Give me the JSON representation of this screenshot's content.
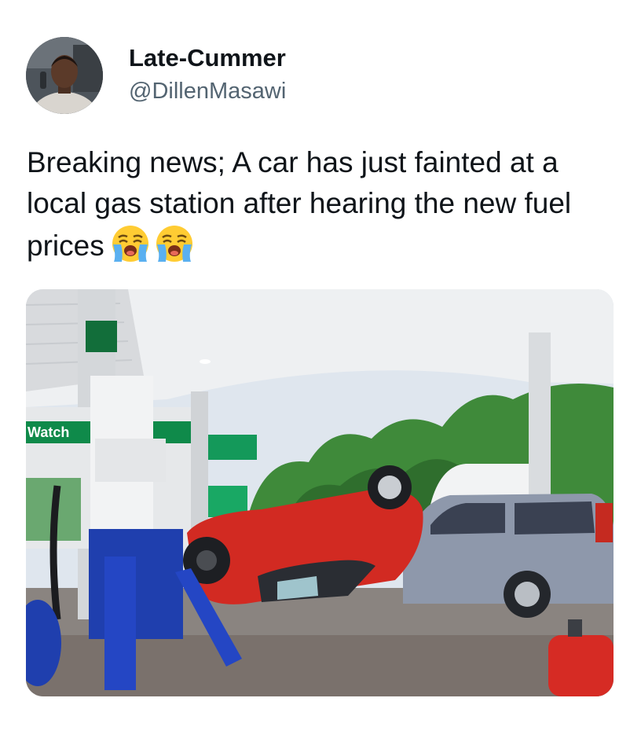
{
  "tweet": {
    "author": {
      "display_name": "Late-Cummer",
      "handle": "@DillenMasawi",
      "avatar_icon": "profile-photo"
    },
    "text": "Breaking news; A car has just fainted at a local gas station after hearing the new fuel prices",
    "emojis": [
      "loudly-crying-face",
      "loudly-crying-face"
    ],
    "media": {
      "type": "photo",
      "sign_text": "Watch"
    }
  },
  "colors": {
    "text_primary": "#0f1419",
    "text_secondary": "#536471",
    "background": "#ffffff",
    "car_red": "#d22a22",
    "pump_blue": "#1f3fae",
    "station_green": "#0f8a4a"
  }
}
